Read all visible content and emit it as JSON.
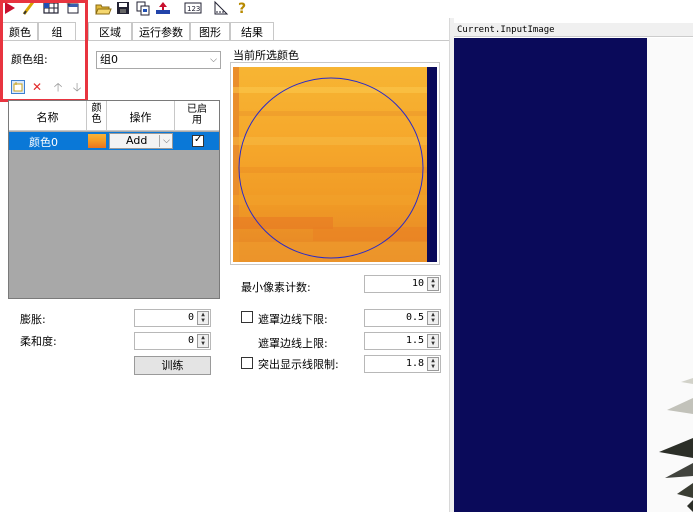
{
  "toolbar": {
    "icons": [
      "run-icon",
      "pen-icon",
      "grid-icon",
      "plus-window-icon",
      "open-folder-icon",
      "save-icon",
      "copy-icon",
      "color-upload-icon",
      "numeric-123-icon",
      "ruler-icon",
      "help-icon"
    ]
  },
  "tabs": [
    "颜色",
    "组",
    "区域",
    "运行参数",
    "图形",
    "结果"
  ],
  "color_group": {
    "label": "颜色组:",
    "value": "组0"
  },
  "table": {
    "headers": [
      "名称",
      "颜\n色",
      "操作",
      "已启\n用"
    ],
    "rows": [
      {
        "name": "颜色0",
        "swatch_color": "#f5a020",
        "operation": "Add",
        "enabled": true
      }
    ]
  },
  "current_color": {
    "label": "当前所选颜色"
  },
  "params_left": {
    "dilate_label": "膨胀:",
    "dilate_value": "0",
    "soften_label": "柔和度:",
    "soften_value": "0",
    "train_label": "训练"
  },
  "params_right": {
    "min_pixels_label": "最小像素计数:",
    "min_pixels_value": "10",
    "mask_lower_label": "遮罩边线下限:",
    "mask_lower_value": "0.5",
    "mask_lower_checked": false,
    "mask_upper_label": "遮罩边线上限:",
    "mask_upper_value": "1.5",
    "highlight_label": "突出显示线限制:",
    "highlight_value": "1.8",
    "highlight_checked": false
  },
  "image_panel": {
    "title": "Current.InputImage"
  },
  "colors": {
    "selection": "#0a78d7",
    "highlight_box": "#e8343f",
    "navy": "#0a0a5a"
  }
}
